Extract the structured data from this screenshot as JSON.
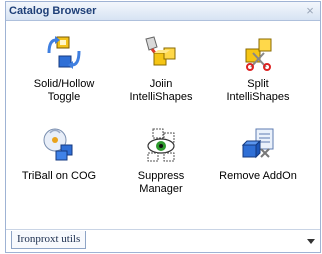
{
  "panel": {
    "title": "Catalog Browser",
    "close_glyph": "×"
  },
  "items": [
    {
      "label": "Solid/Hollow\nToggle",
      "icon": "solid-hollow-toggle-icon"
    },
    {
      "label": "Joiin\nIntelliShapes",
      "icon": "join-intellishapes-icon"
    },
    {
      "label": "Split\nIntelliShapes",
      "icon": "split-intellishapes-icon"
    },
    {
      "label": "TriBall on COG",
      "icon": "triball-on-cog-icon"
    },
    {
      "label": "Suppress\nManager",
      "icon": "suppress-manager-icon"
    },
    {
      "label": "Remove AddOn",
      "icon": "remove-addon-icon"
    }
  ],
  "tabs": [
    {
      "label": "Ironproxt utils",
      "active": true
    }
  ],
  "colors": {
    "title_text": "#1e3f77",
    "panel_border": "#9fb3d4"
  }
}
